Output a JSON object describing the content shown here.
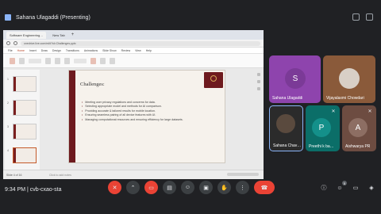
{
  "presentation_banner": {
    "text": "Sahana Ulagaddi (Presenting)"
  },
  "browser": {
    "tabs": [
      "Software Engineering…",
      "New Tab"
    ],
    "url": "onedrive.live.com/edit?id=Challenges.pptx",
    "menu": [
      "File",
      "Home",
      "Insert",
      "Draw",
      "Design",
      "Transitions",
      "Animations",
      "Slide Show",
      "Review",
      "View",
      "Help"
    ]
  },
  "slide": {
    "title": "Challenges:",
    "bullets": [
      "Meeting user privacy regulations and concerns for data.",
      "Selecting appropriate model and methods for AI comparison.",
      "Providing accurate & tailored results for mobile location.",
      "Ensuring seamless pairing of all device features with UI.",
      "Managing computational resources and ensuring efficiency for large datasets."
    ]
  },
  "thumbnails": [
    "1",
    "2",
    "3",
    "4"
  ],
  "status": {
    "left": "Slide 4 of 16",
    "notes": "Click to add notes"
  },
  "participants": [
    {
      "name": "Sahana Ulagaddi",
      "initial": "S",
      "color": "#8e44ad"
    },
    {
      "name": "Vijayalaxmi Chowdari",
      "initial": "",
      "color": "#c9b8a8"
    },
    {
      "name": "Sahana Chav…",
      "initial": "",
      "color": "#3a3a3a"
    },
    {
      "name": "Preethi k ba…",
      "initial": "P",
      "color": "#12807a"
    },
    {
      "name": "Aishwarya PR",
      "initial": "A",
      "color": "#7d5a4e"
    }
  ],
  "meeting": {
    "time": "9:34 PM",
    "code": "cvb-cxao-sta"
  },
  "badges": {
    "people": "5"
  }
}
